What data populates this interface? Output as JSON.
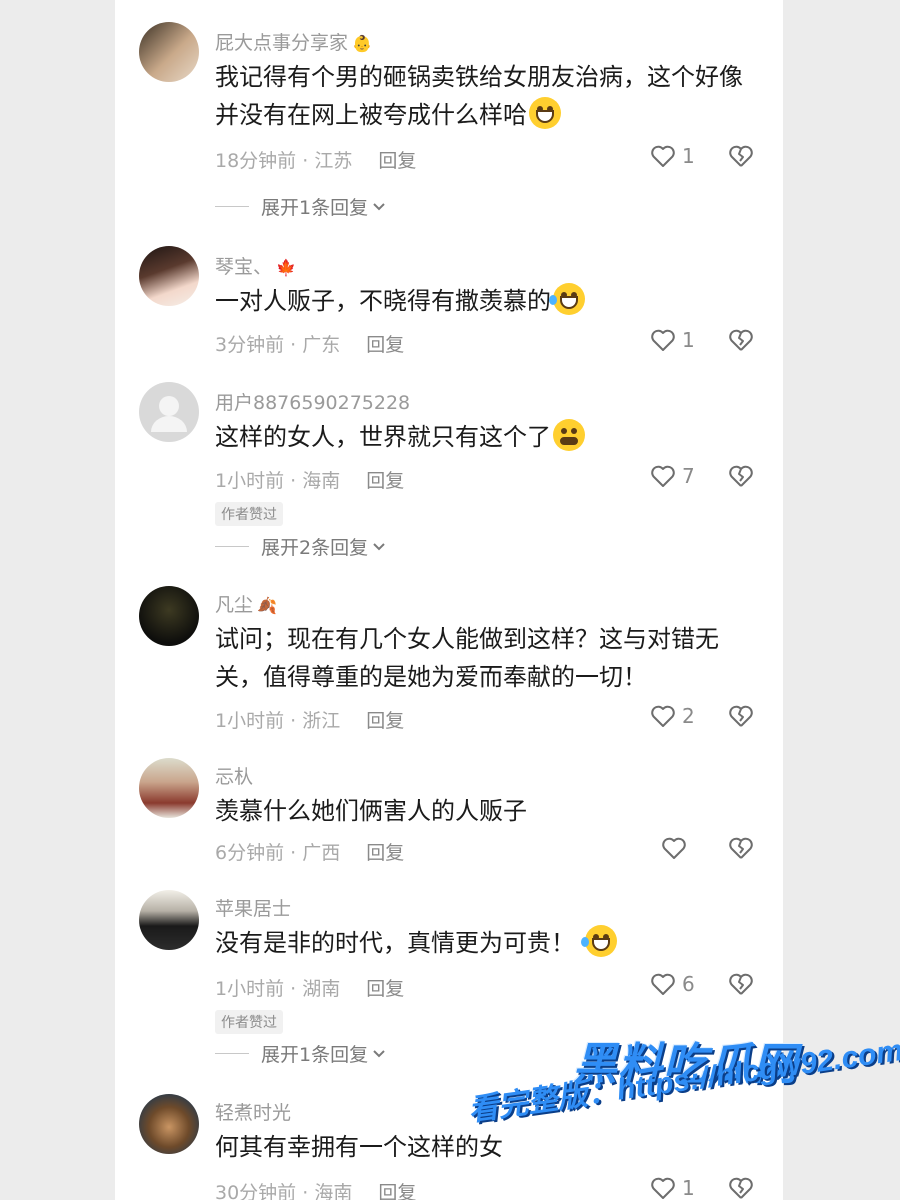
{
  "comments": [
    {
      "username": "屁大点事分享家",
      "badge": "👶",
      "text": "我记得有个男的砸锅卖铁给女朋友治病，这个好像并没有在网上被夸成什么样哈",
      "emoji": "grinning-sweat",
      "time": "18分钟前",
      "location": "江苏",
      "reply_label": "回复",
      "likes": "1",
      "expand_label": "展开1条回复"
    },
    {
      "username": "琴宝、",
      "badge": "🍁",
      "text": "一对人贩子，不晓得有撒羡慕的",
      "emoji": "laughing-tears",
      "time": "3分钟前",
      "location": "广东",
      "reply_label": "回复",
      "likes": "1"
    },
    {
      "username": "用户8876590275228",
      "text": "这样的女人，世界就只有这个了",
      "emoji": "smirk-face",
      "time": "1小时前",
      "location": "海南",
      "reply_label": "回复",
      "likes": "7",
      "author_badge": "作者赞过",
      "expand_label": "展开2条回复"
    },
    {
      "username": "凡尘",
      "badge": "🍂",
      "text": "试问；现在有几个女人能做到这样？这与对错无关，值得尊重的是她为爱而奉献的一切！",
      "time": "1小时前",
      "location": "浙江",
      "reply_label": "回复",
      "likes": "2"
    },
    {
      "username": "忈朲",
      "text": "羡慕什么她们俩害人的人贩子",
      "time": "6分钟前",
      "location": "广西",
      "reply_label": "回复",
      "likes": ""
    },
    {
      "username": "苹果居士",
      "text": "没有是非的时代，真情更为可贵！",
      "emoji": "laughing-tears",
      "time": "1小时前",
      "location": "湖南",
      "reply_label": "回复",
      "likes": "6",
      "author_badge": "作者赞过",
      "expand_label": "展开1条回复"
    },
    {
      "username": "轻煮时光",
      "text": "何其有幸拥有一个这样的女",
      "time": "30分钟前",
      "location": "海南",
      "reply_label": "回复",
      "likes": "1"
    }
  ],
  "watermark": {
    "title": "黑料吃瓜网",
    "subtitle": "看完整版：https://hlcgw92.com"
  },
  "colors": {
    "accent_watermark": "#2f8df5",
    "text_primary": "#1b1b1b",
    "text_secondary": "#9a9a9a"
  }
}
